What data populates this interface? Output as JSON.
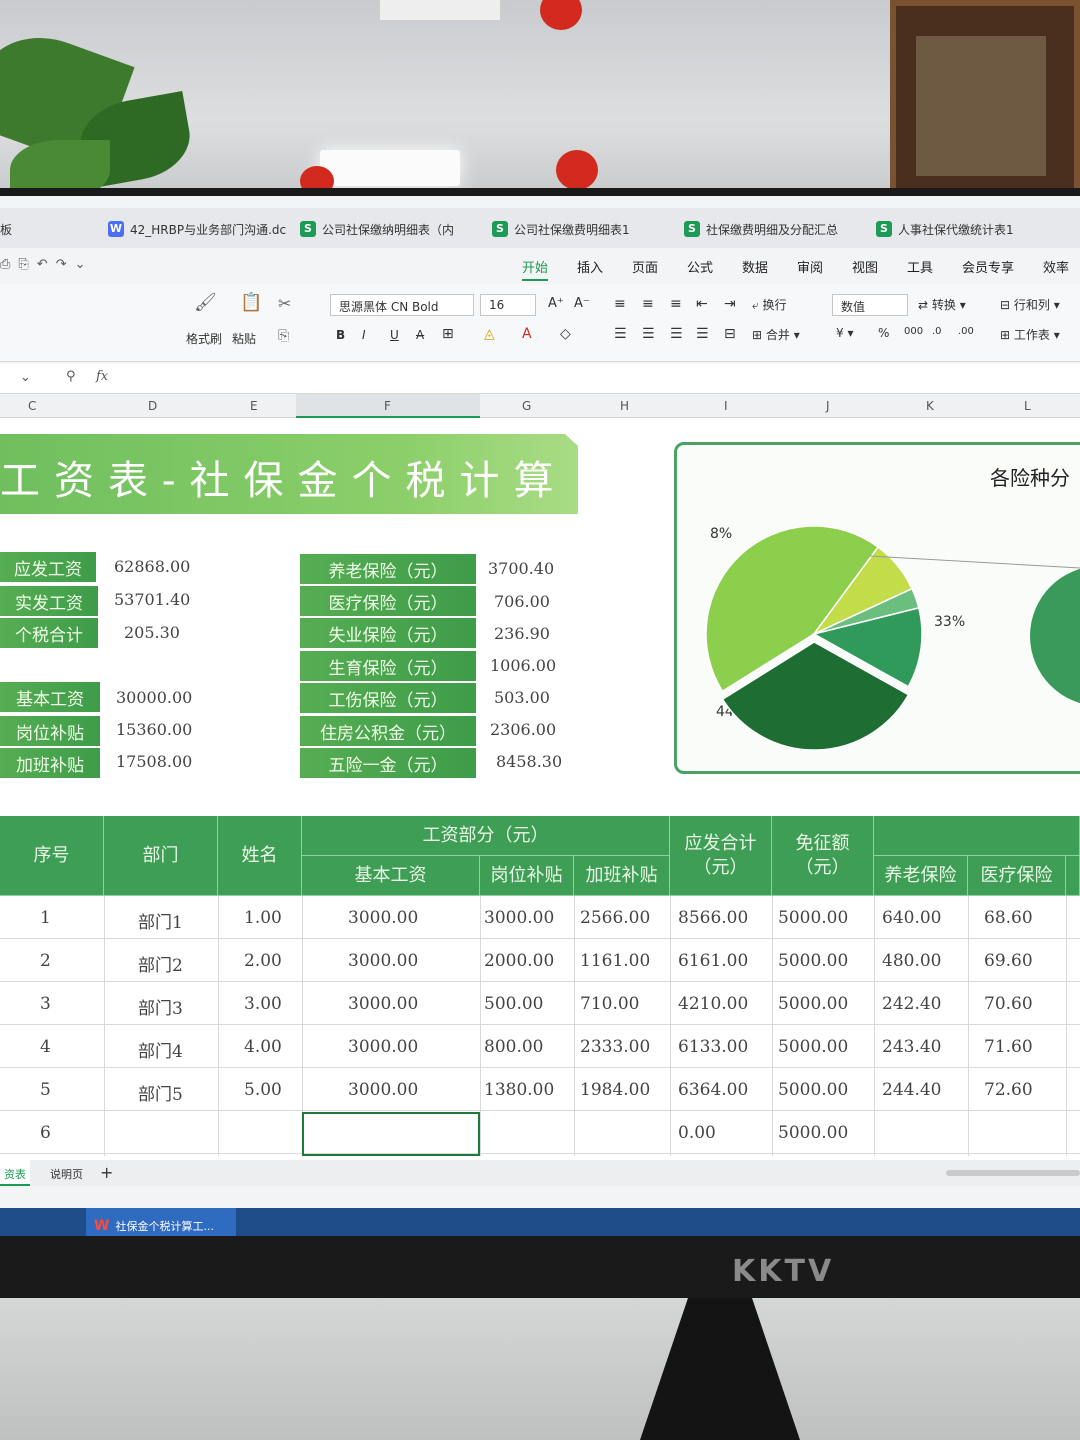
{
  "tabs": [
    {
      "icon": "W",
      "label": "42_HRBP与业务部门沟通.dc"
    },
    {
      "icon": "S",
      "label": "公司社保缴纳明细表（内"
    },
    {
      "icon": "S",
      "label": "公司社保缴费明细表1"
    },
    {
      "icon": "S",
      "label": "社保缴费明细及分配汇总"
    },
    {
      "icon": "S",
      "label": "人事社保代缴统计表1"
    }
  ],
  "tab_fragment": "板",
  "menu": [
    "开始",
    "插入",
    "页面",
    "公式",
    "数据",
    "审阅",
    "视图",
    "工具",
    "会员专享",
    "效率"
  ],
  "ribbon": {
    "format_brush": "格式刷",
    "paste": "粘贴",
    "font_name": "思源黑体 CN Bold",
    "font_size": "16",
    "wrap": "换行",
    "merge": "合并",
    "number_format": "数值",
    "convert": "转换",
    "row_col": "行和列",
    "worksheet": "工作表"
  },
  "formula": {
    "fx": "fx"
  },
  "columns": [
    "C",
    "D",
    "E",
    "F",
    "G",
    "H",
    "I",
    "J",
    "K",
    "L"
  ],
  "title": "工资表-社保金个税计算",
  "summary_left": [
    {
      "label": "应发工资",
      "value": "62868.00"
    },
    {
      "label": "实发工资",
      "value": "53701.40"
    },
    {
      "label": "个税合计",
      "value": "205.30"
    },
    {
      "label": "基本工资",
      "value": "30000.00"
    },
    {
      "label": "岗位补贴",
      "value": "15360.00"
    },
    {
      "label": "加班补贴",
      "value": "17508.00"
    }
  ],
  "summary_right": [
    {
      "label": "养老保险（元）",
      "value": "3700.40"
    },
    {
      "label": "医疗保险（元）",
      "value": "706.00"
    },
    {
      "label": "失业保险（元）",
      "value": "236.90"
    },
    {
      "label": "生育保险（元）",
      "value": "1006.00"
    },
    {
      "label": "工伤保险（元）",
      "value": "503.00"
    },
    {
      "label": "住房公积金（元）",
      "value": "2306.00"
    },
    {
      "label": "五险一金（元）",
      "value": "8458.30"
    }
  ],
  "chart_data": {
    "type": "pie",
    "title": "各险种分",
    "values": [
      44,
      8,
      3,
      12,
      33
    ],
    "labels": [
      "44%",
      "8%",
      "3%",
      "12%",
      "33%"
    ],
    "colors": [
      "#8ccf4d",
      "#c3dc4a",
      "#6bbf7e",
      "#2f9a5a",
      "#1e6e33"
    ]
  },
  "table": {
    "headers": {
      "seq": "序号",
      "dept": "部门",
      "name": "姓名",
      "wage_group": "工资部分（元）",
      "basic": "基本工资",
      "post": "岗位补贴",
      "overtime": "加班补贴",
      "gross": "应发合计（元）",
      "exempt": "免征额（元）",
      "pension": "养老保险",
      "medical": "医疗保险"
    },
    "rows": [
      {
        "seq": "1",
        "dept": "部门1",
        "name": "1.00",
        "basic": "3000.00",
        "post": "3000.00",
        "overtime": "2566.00",
        "gross": "8566.00",
        "exempt": "5000.00",
        "pension": "640.00",
        "medical": "68.60"
      },
      {
        "seq": "2",
        "dept": "部门2",
        "name": "2.00",
        "basic": "3000.00",
        "post": "2000.00",
        "overtime": "1161.00",
        "gross": "6161.00",
        "exempt": "5000.00",
        "pension": "480.00",
        "medical": "69.60"
      },
      {
        "seq": "3",
        "dept": "部门3",
        "name": "3.00",
        "basic": "3000.00",
        "post": "500.00",
        "overtime": "710.00",
        "gross": "4210.00",
        "exempt": "5000.00",
        "pension": "242.40",
        "medical": "70.60"
      },
      {
        "seq": "4",
        "dept": "部门4",
        "name": "4.00",
        "basic": "3000.00",
        "post": "800.00",
        "overtime": "2333.00",
        "gross": "6133.00",
        "exempt": "5000.00",
        "pension": "243.40",
        "medical": "71.60"
      },
      {
        "seq": "5",
        "dept": "部门5",
        "name": "5.00",
        "basic": "3000.00",
        "post": "1380.00",
        "overtime": "1984.00",
        "gross": "6364.00",
        "exempt": "5000.00",
        "pension": "244.40",
        "medical": "72.60"
      },
      {
        "seq": "6",
        "dept": "",
        "name": "",
        "basic": "",
        "post": "",
        "overtime": "",
        "gross": "0.00",
        "exempt": "5000.00",
        "pension": "",
        "medical": ""
      }
    ]
  },
  "sheet_tabs": [
    "资表",
    "说明页"
  ],
  "add_sheet": "+",
  "taskbar_app": "社保金个税计算工...",
  "monitor_brand": "KKTV"
}
